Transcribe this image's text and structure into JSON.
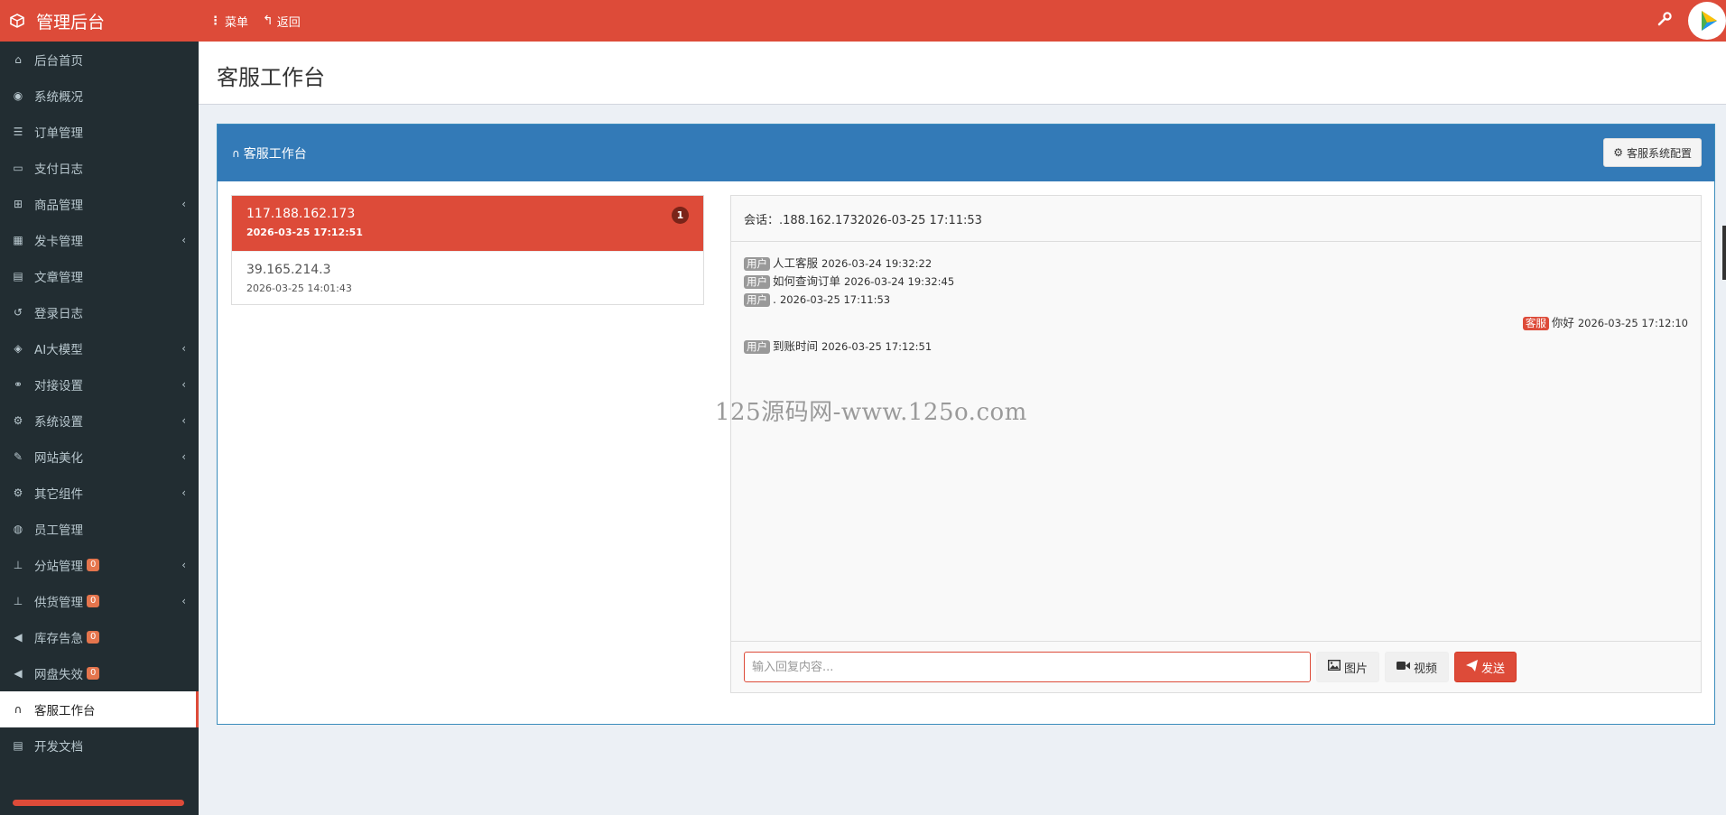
{
  "brand": {
    "title": "管理后台"
  },
  "topnav": {
    "menu_label": "菜单",
    "back_label": "返回"
  },
  "sidebar": {
    "items": [
      {
        "label": "后台首页",
        "icon": "home-icon",
        "glyph": "⌂"
      },
      {
        "label": "系统概况",
        "icon": "dashboard-icon",
        "glyph": "◉"
      },
      {
        "label": "订单管理",
        "icon": "list-icon",
        "glyph": "☰"
      },
      {
        "label": "支付日志",
        "icon": "credit-card-icon",
        "glyph": "▭"
      },
      {
        "label": "商品管理",
        "icon": "cart-icon",
        "glyph": "⊞",
        "chevron": true
      },
      {
        "label": "发卡管理",
        "icon": "grid-icon",
        "glyph": "▦",
        "chevron": true
      },
      {
        "label": "文章管理",
        "icon": "book-icon",
        "glyph": "▤"
      },
      {
        "label": "登录日志",
        "icon": "history-icon",
        "glyph": "↺"
      },
      {
        "label": "AI大模型",
        "icon": "ai-icon",
        "glyph": "◈",
        "chevron": true
      },
      {
        "label": "对接设置",
        "icon": "link-icon",
        "glyph": "⚭",
        "chevron": true
      },
      {
        "label": "系统设置",
        "icon": "gear-icon",
        "glyph": "⚙",
        "chevron": true
      },
      {
        "label": "网站美化",
        "icon": "brush-icon",
        "glyph": "✎",
        "chevron": true
      },
      {
        "label": "其它组件",
        "icon": "cogs-icon",
        "glyph": "⚙",
        "chevron": true
      },
      {
        "label": "员工管理",
        "icon": "user-circle-icon",
        "glyph": "◍"
      },
      {
        "label": "分站管理",
        "icon": "sitemap-icon",
        "glyph": "⊥",
        "badge": "0",
        "chevron": true
      },
      {
        "label": "供货管理",
        "icon": "sitemap-icon",
        "glyph": "⊥",
        "badge": "0",
        "chevron": true
      },
      {
        "label": "库存告急",
        "icon": "bullhorn-icon",
        "glyph": "◀",
        "badge": "0"
      },
      {
        "label": "网盘失效",
        "icon": "bullhorn-icon",
        "glyph": "◀",
        "badge": "0"
      },
      {
        "label": "客服工作台",
        "icon": "headset-icon",
        "glyph": "∩",
        "active": true
      },
      {
        "label": "开发文档",
        "icon": "book-icon",
        "glyph": "▤"
      }
    ]
  },
  "page": {
    "title": "客服工作台"
  },
  "box": {
    "title": "客服工作台",
    "config_button": "客服系统配置"
  },
  "sessions": [
    {
      "ip": "117.188.162.173",
      "time": "2026-03-25 17:12:51",
      "unread": "1",
      "active": true
    },
    {
      "ip": "39.165.214.3",
      "time": "2026-03-25 14:01:43",
      "active": false
    }
  ],
  "chat": {
    "header": "会话：.188.162.1732026-03-25 17:11:53",
    "messages": [
      {
        "role": "user",
        "tag": "用户",
        "text": "人工客服",
        "time": "2026-03-24 19:32:22"
      },
      {
        "role": "user",
        "tag": "用户",
        "text": "如何查询订单",
        "time": "2026-03-24 19:32:45"
      },
      {
        "role": "user",
        "tag": "用户",
        "text": ".",
        "time": "2026-03-25 17:11:53"
      },
      {
        "role": "cs",
        "tag": "客服",
        "text": "你好",
        "time": "2026-03-25 17:12:10"
      },
      {
        "role": "user",
        "tag": "用户",
        "text": "到账时间",
        "time": "2026-03-25 17:12:51"
      }
    ],
    "input_placeholder": "输入回复内容...",
    "input_value": "",
    "image_button": "图片",
    "video_button": "视频",
    "send_button": "发送"
  },
  "watermark": "125源码网-www.125o.com",
  "colors": {
    "primary_red": "#dd4b39",
    "header_blue": "#337ab7",
    "sidebar_bg": "#222d32"
  }
}
